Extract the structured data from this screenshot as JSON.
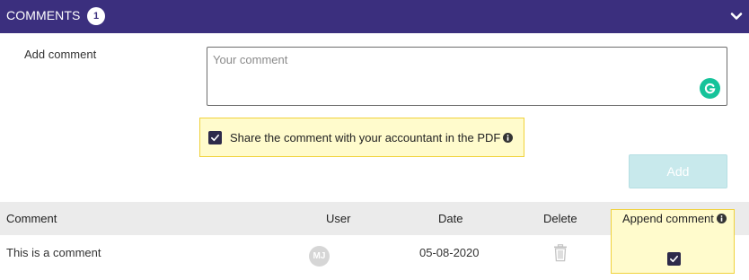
{
  "header": {
    "title": "COMMENTS",
    "count": "1",
    "chevron_icon": "chevron-down-icon"
  },
  "form": {
    "add_label": "Add comment",
    "comment_placeholder": "Your comment",
    "comment_value": "",
    "grammarly_icon": "grammarly-icon",
    "share_label": "Share the comment with your accountant in the PDF",
    "share_checked": true,
    "add_button_label": "Add"
  },
  "table": {
    "columns": {
      "comment": "Comment",
      "user": "User",
      "date": "Date",
      "delete": "Delete",
      "append": "Append comment"
    },
    "rows": [
      {
        "comment": "This is a comment",
        "user_initials": "MJ",
        "date": "05-08-2020",
        "delete_icon": "trash-icon",
        "append_checked": true
      }
    ]
  },
  "colors": {
    "header_bg": "#3b2f7e",
    "highlight_bg": "#fffbcc",
    "highlight_border": "#f0d23c",
    "checkbox": "#2d2a4a",
    "add_button_bg": "#c8e9ec",
    "grammarly": "#15c39a"
  }
}
